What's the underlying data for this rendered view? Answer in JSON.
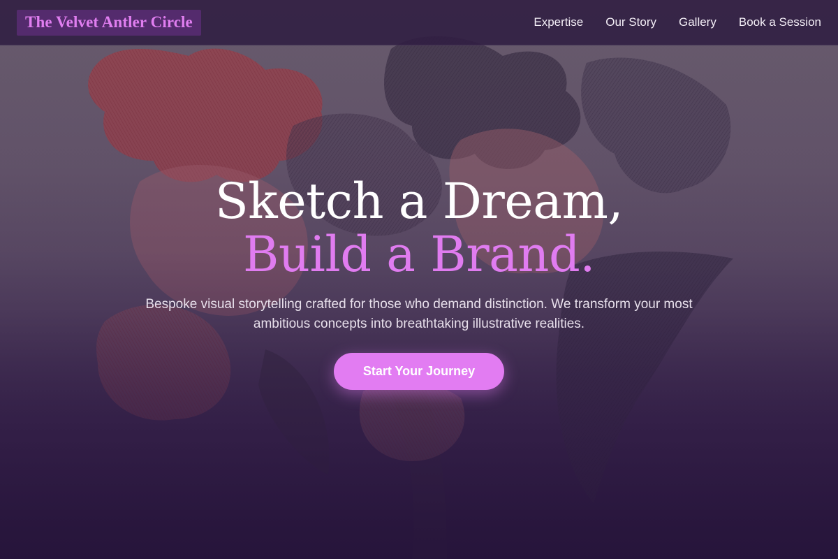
{
  "nav": {
    "brand": "The Velvet Antler Circle",
    "links": [
      {
        "label": "Expertise"
      },
      {
        "label": "Our Story"
      },
      {
        "label": "Gallery"
      },
      {
        "label": "Book a Session"
      }
    ]
  },
  "hero": {
    "headline_line1": "Sketch a Dream,",
    "headline_line2": "Build a Brand.",
    "tagline": "Bespoke visual storytelling crafted for those who demand distinction. We transform your most ambitious concepts into breathtaking illustrative realities.",
    "cta_label": "Start Your Journey",
    "background_image": "floral-engraving-illustration"
  },
  "colors": {
    "accent": "#e07cf0",
    "nav_background": "#301e42",
    "page_background": "#2a1a3e"
  }
}
